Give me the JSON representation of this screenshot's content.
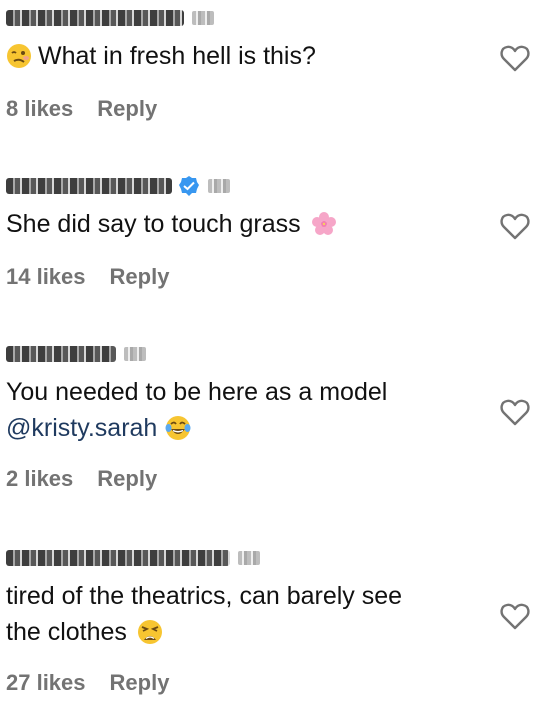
{
  "comments": [
    {
      "text": "What in fresh hell is this?",
      "emoji_lead": "woozy-face-emoji",
      "likes": "8 likes",
      "reply": "Reply"
    },
    {
      "text": "She did say to touch grass",
      "emoji_trail": "cherry-blossom-emoji",
      "likes": "14 likes",
      "reply": "Reply"
    },
    {
      "text_line1": "You needed to be here as a model",
      "mention": "@kristy.sarah",
      "emoji_trail": "tears-of-joy-emoji",
      "likes": "2 likes",
      "reply": "Reply"
    },
    {
      "text_line1": "tired of the theatrics, can barely see",
      "text_line2": "the clothes",
      "emoji_trail": "weary-face-emoji",
      "likes": "27 likes",
      "reply": "Reply"
    }
  ],
  "colors": {
    "meta_gray": "#737373",
    "mention_blue": "#1f3a5f",
    "verified_blue": "#3897f0"
  }
}
